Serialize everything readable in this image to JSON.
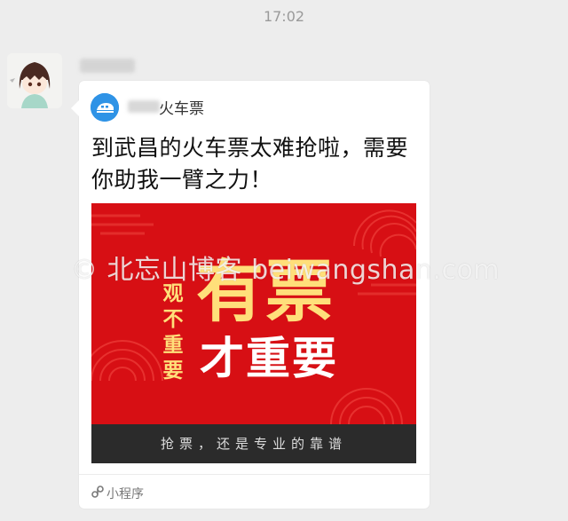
{
  "chat": {
    "timestamp": "17:02"
  },
  "card": {
    "app_name": "火车票",
    "title": "到武昌的火车票太难抢啦，需要你助我一臂之力！",
    "banner": {
      "headline_line1": "有票",
      "headline_line2": "才重要",
      "vertical_text": "观不重要",
      "footer_slogan": "抢票，还是专业的靠谱"
    },
    "footer_label": "小程序"
  },
  "watermark": "© 北忘山博客 beiwangshan.com",
  "colors": {
    "background": "#ededed",
    "banner_red": "#d70f14",
    "headline_gold": "#ffdf7a",
    "app_icon_blue": "#2f93e6"
  }
}
